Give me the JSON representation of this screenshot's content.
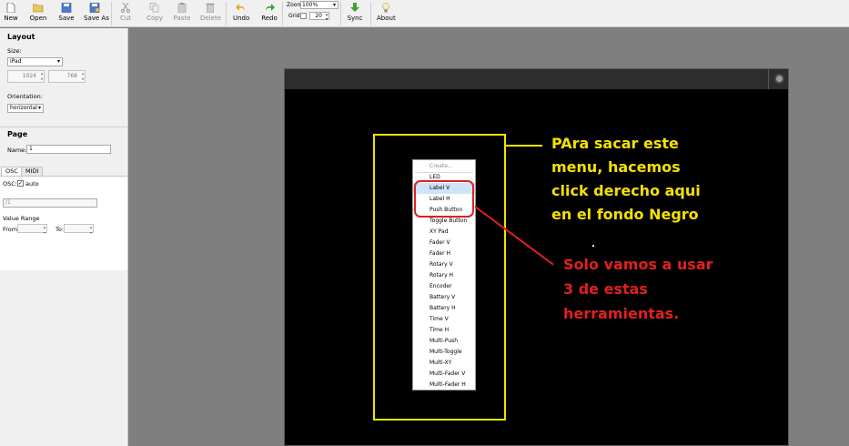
{
  "toolbar": {
    "new": "New",
    "open": "Open",
    "save": "Save",
    "save_as": "Save As",
    "cut": "Cut",
    "copy": "Copy",
    "paste": "Paste",
    "delete": "Delete",
    "undo": "Undo",
    "redo": "Redo",
    "zoom_label": "Zoom",
    "zoom_value": "100%",
    "grid_label": "Grid",
    "grid_value": "20",
    "sync": "Sync",
    "about": "About"
  },
  "layout": {
    "title": "Layout",
    "size_label": "Size:",
    "size_value": "iPad",
    "width": "1024",
    "height": "768",
    "orientation_label": "Orientation:",
    "orientation_value": "horizontal"
  },
  "page": {
    "title": "Page",
    "name_label": "Name:",
    "name_value": "1",
    "tabs": [
      "OSC",
      "MIDI"
    ],
    "osc_label": "OSC:",
    "osc_checked": "✓",
    "auto_label": "auto",
    "osc_address": "/1",
    "value_range_label": "Value Range",
    "from_label": "From:",
    "to_label": "To:"
  },
  "context_menu": {
    "header": "Create...",
    "items": [
      "LED",
      "Label V",
      "Label H",
      "Push Button",
      "Toggle Button",
      "XY Pad",
      "Fader V",
      "Fader H",
      "Rotary V",
      "Rotary H",
      "Encoder",
      "Battery V",
      "Battery H",
      "Time V",
      "Time H",
      "Multi-Push",
      "Multi-Toggle",
      "Multi-XY",
      "Multi-Fader V",
      "Multi-Fader H"
    ]
  },
  "annotations": {
    "yellow": [
      "PAra sacar este",
      "menu, hacemos",
      "click derecho aqui",
      "en el fondo Negro"
    ],
    "red": [
      "Solo vamos a usar",
      "3 de estas",
      "herramientas."
    ]
  },
  "colors": {
    "annotation_yellow": "#f5e100",
    "annotation_red": "#e02020",
    "canvas_bg": "#000000",
    "workarea_bg": "#7f7f7f"
  }
}
